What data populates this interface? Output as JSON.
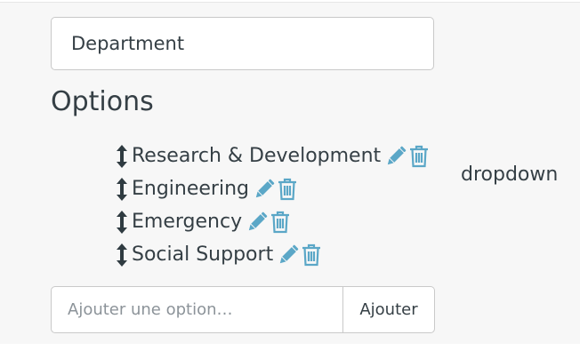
{
  "field": {
    "name_value": "Department",
    "name_placeholder": "",
    "type": "dropdown"
  },
  "options_section": {
    "heading": "Options",
    "items": [
      {
        "label": "Research & Development"
      },
      {
        "label": "Engineering"
      },
      {
        "label": "Emergency"
      },
      {
        "label": "Social Support"
      }
    ]
  },
  "add_option": {
    "placeholder": "Ajouter une option…",
    "value": "",
    "button_label": "Ajouter"
  },
  "icons": {
    "drag": "drag-vertical-arrows-icon",
    "edit": "pencil-icon",
    "delete": "trash-icon"
  },
  "colors": {
    "text": "#353f45",
    "action_icon": "#5ba7c7",
    "panel_background": "#f7f7f7",
    "input_border": "#c9c9c9"
  }
}
